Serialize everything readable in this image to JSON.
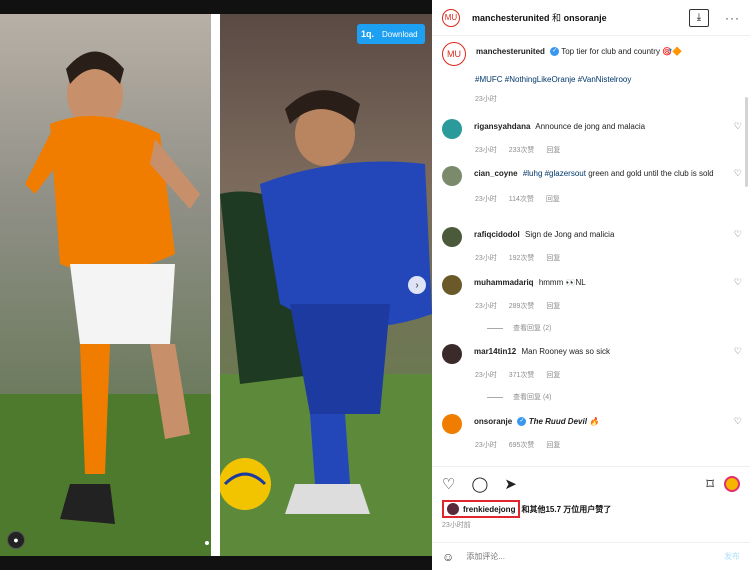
{
  "header": {
    "account": "manchesterunited",
    "connector": "和",
    "collab": "onsoranje"
  },
  "download_button": {
    "logo": "1q.",
    "label": "Download"
  },
  "post": {
    "author": "manchesterunited",
    "caption": "Top tier for club and country 🎯🔶",
    "hashtags": "#MUFC #NothingLikeOranje #VanNistelrooy",
    "time": "23小时"
  },
  "comments": [
    {
      "user": "rigansyahdana",
      "text": "Announce de jong and malacia",
      "time": "23小时",
      "likes": "233次赞",
      "reply": "回复",
      "avatar_color": "#2a9a9a"
    },
    {
      "user": "cian_coyne",
      "tags": "#luhg #glazersout",
      "text": "green and gold until the club is sold",
      "time": "23小时",
      "likes": "114次赞",
      "reply": "回复",
      "avatar_color": "#7a8a6a"
    },
    {
      "user": "rafiqcidodol",
      "text": "Sign de Jong and malicia",
      "time": "23小时",
      "likes": "192次赞",
      "reply": "回复",
      "avatar_color": "#4a5a3a"
    },
    {
      "user": "muhammadariq",
      "text": "hmmm 👀NL",
      "time": "23小时",
      "likes": "289次赞",
      "reply": "回复",
      "avatar_color": "#6a5a2a",
      "view_replies": "查看回复 (2)"
    },
    {
      "user": "mar14tin12",
      "text": "Man Rooney was so sick",
      "time": "23小时",
      "likes": "371次赞",
      "reply": "回复",
      "avatar_color": "#3a2a2a",
      "view_replies": "查看回复 (4)"
    },
    {
      "user": "onsoranje",
      "text": "The Ruud Devil 🔥",
      "time": "23小时",
      "likes": "695次赞",
      "reply": "回复",
      "avatar_color": "#f07d00"
    }
  ],
  "likes": {
    "highlighted_user": "frenkiedejong",
    "rest": "和其他15.7 万位用户赞了"
  },
  "post_time": "23小时前",
  "add_comment": {
    "placeholder": "添加评论...",
    "post_label": "发布"
  },
  "colors": {
    "mu_red": "#da291c",
    "oranje": "#f07d00",
    "link": "#00376b",
    "highlight": "#e0252b"
  }
}
